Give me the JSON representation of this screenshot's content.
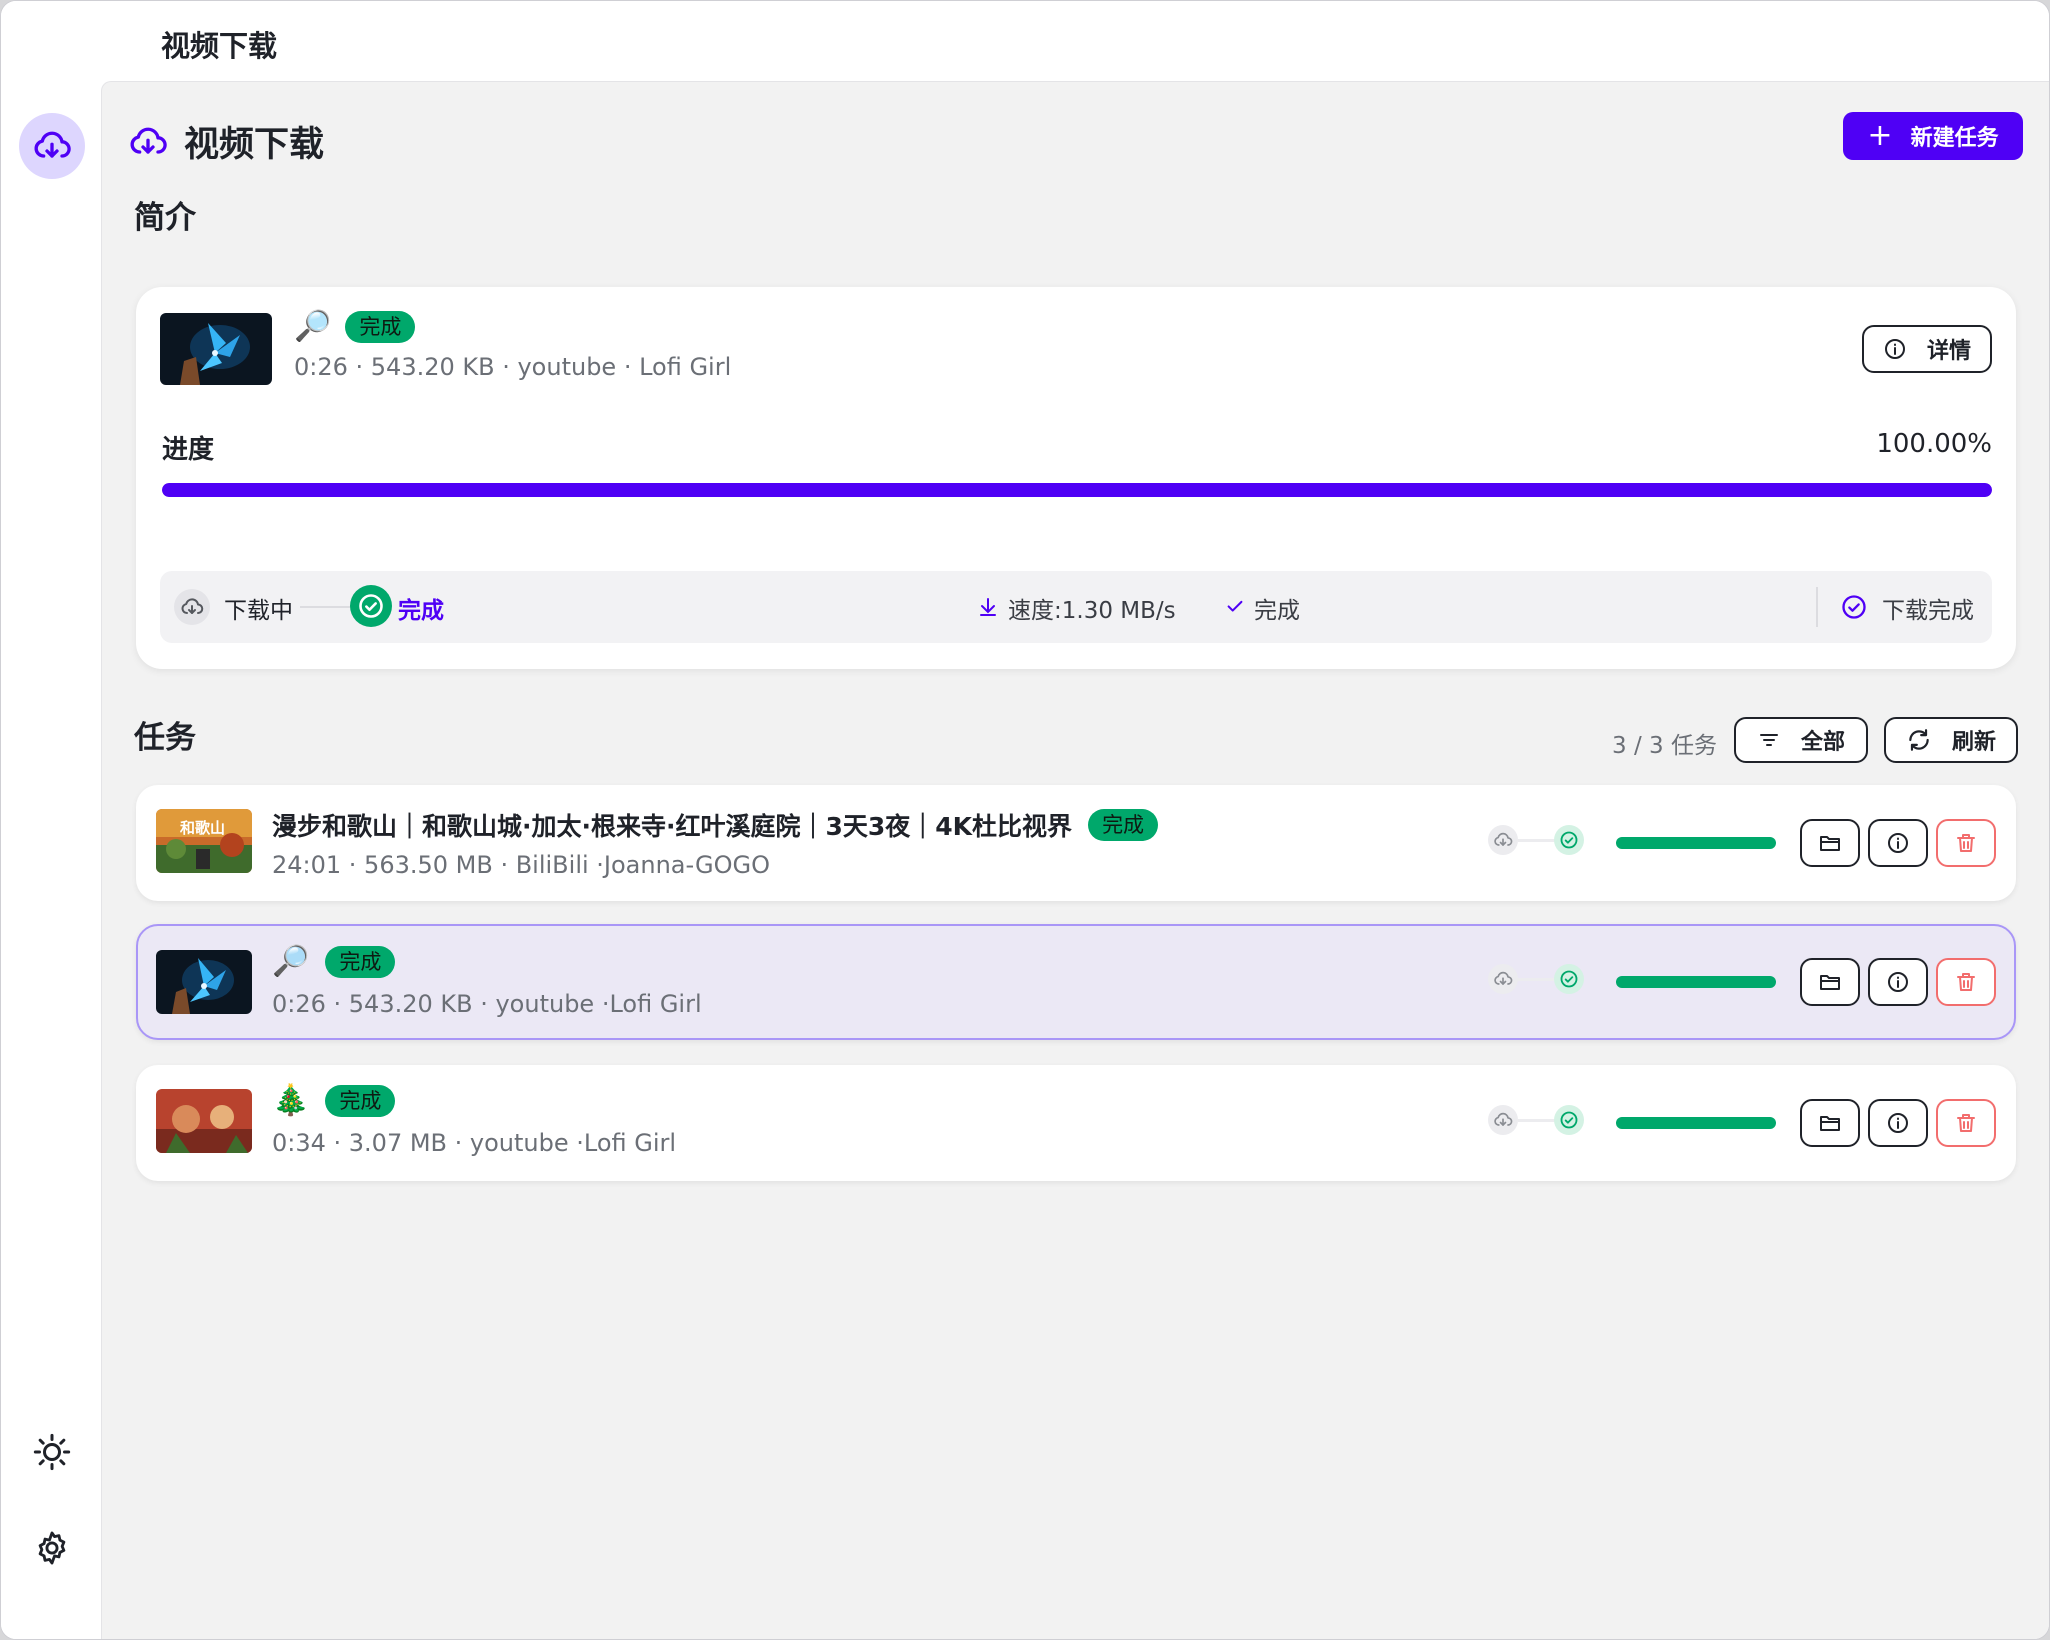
{
  "window": {
    "title": "视频下载"
  },
  "header": {
    "title": "视频下载",
    "new_task_label": "新建任务"
  },
  "sidebar": {
    "items": [
      {
        "icon": "download-cloud-icon",
        "active": true
      },
      {
        "icon": "sun-icon"
      },
      {
        "icon": "gear-icon"
      }
    ]
  },
  "summary": {
    "section_title": "简介",
    "emoji": "🔎",
    "status": "完成",
    "meta": "0:26 · 543.20 KB · youtube · Lofi Girl",
    "details_label": "详情",
    "progress_label": "进度",
    "progress_text": "100.00%",
    "progress_value": 1.0,
    "steps": {
      "downloading": "下载中",
      "done": "完成"
    },
    "speed": "速度:1.30 MB/s",
    "state": "完成",
    "final_state": "下载完成"
  },
  "tasks": {
    "section_title": "任务",
    "count": "3 / 3 任务",
    "filter_label": "全部",
    "refresh_label": "刷新",
    "items": [
      {
        "title": "漫步和歌山｜和歌山城·加太·根来寺·红叶溪庭院｜3天3夜｜4K杜比视界",
        "status": "完成",
        "meta": "24:01 · 563.50 MB · BiliBili ·Joanna-GOGO",
        "thumb_label": "和歌山",
        "progress_value": 1.0
      },
      {
        "title": "🔎",
        "status": "完成",
        "meta": "0:26 · 543.20 KB · youtube ·Lofi Girl",
        "progress_value": 1.0
      },
      {
        "title": "🎄",
        "status": "完成",
        "meta": "0:34 · 3.07 MB · youtube ·Lofi Girl",
        "progress_value": 1.0
      }
    ]
  },
  "colors": {
    "accent": "#4f00f5",
    "success": "#00a86b",
    "danger": "#f26d6d"
  }
}
